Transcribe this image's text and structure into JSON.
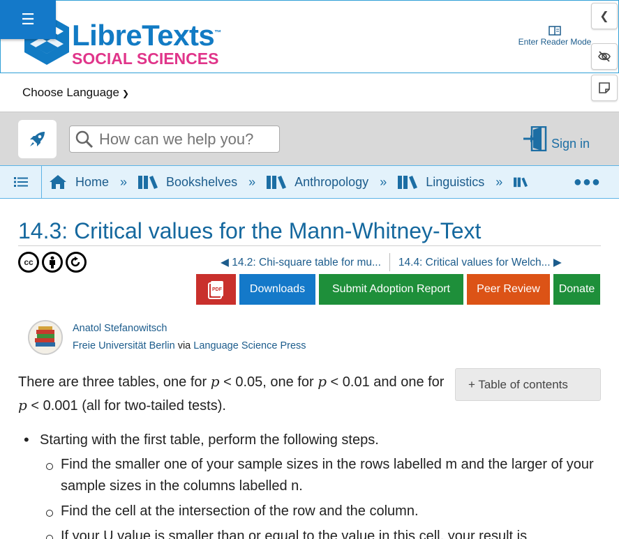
{
  "header": {
    "menu_icon": "hamburger-icon",
    "logo_word": "LibreTexts",
    "logo_tm": "™",
    "logo_sub": "SOCIAL SCIENCES",
    "reader_mode_label": "Enter Reader Mode",
    "language_label": "Choose Language"
  },
  "side_buttons": [
    "chevron-left-icon",
    "eye-off-icon",
    "sticky-note-icon"
  ],
  "search": {
    "placeholder": "How can we help you?",
    "signin_label": "Sign in"
  },
  "breadcrumb": {
    "items": [
      {
        "label": "Home",
        "icon": "home-icon"
      },
      {
        "label": "Bookshelves",
        "icon": "books-icon"
      },
      {
        "label": "Anthropology",
        "icon": "books-icon"
      },
      {
        "label": "Linguistics",
        "icon": "books-icon"
      }
    ],
    "separator": "»"
  },
  "page": {
    "title": "14.3: Critical values for the Mann-Whitney-Text",
    "prev_label": "◀ 14.2: Chi-square table for mu...",
    "next_label": "14.4: Critical values for Welch... ▶"
  },
  "actions": {
    "pdf_label": "PDF",
    "downloads_label": "Downloads",
    "adoption_label": "Submit Adoption Report",
    "peer_label": "Peer Review",
    "donate_label": "Donate"
  },
  "author": {
    "name": "Anatol Stefanowitsch",
    "institution": "Freie Universität Berlin",
    "via": "via",
    "publisher": "Language Science Press"
  },
  "content": {
    "intro_a": "There are three tables, one for ",
    "p1": "p",
    "cmp1": " < 0.05, one for ",
    "p2": "p",
    "cmp2": " < 0.01 and one for ",
    "p3": "p",
    "cmp3": " < 0.001 (all for two-tailed tests).",
    "toc_label": "+ Table of contents",
    "step1": "Starting with the first table, perform the following steps.",
    "sub1": "Find the smaller one of your sample sizes in the rows labelled m and the larger of your sample sizes in the columns labelled n.",
    "sub2": "Find the cell at the intersection of the row and the column.",
    "sub3": "If your U value is smaller than or equal to the value in this cell, your result is"
  }
}
